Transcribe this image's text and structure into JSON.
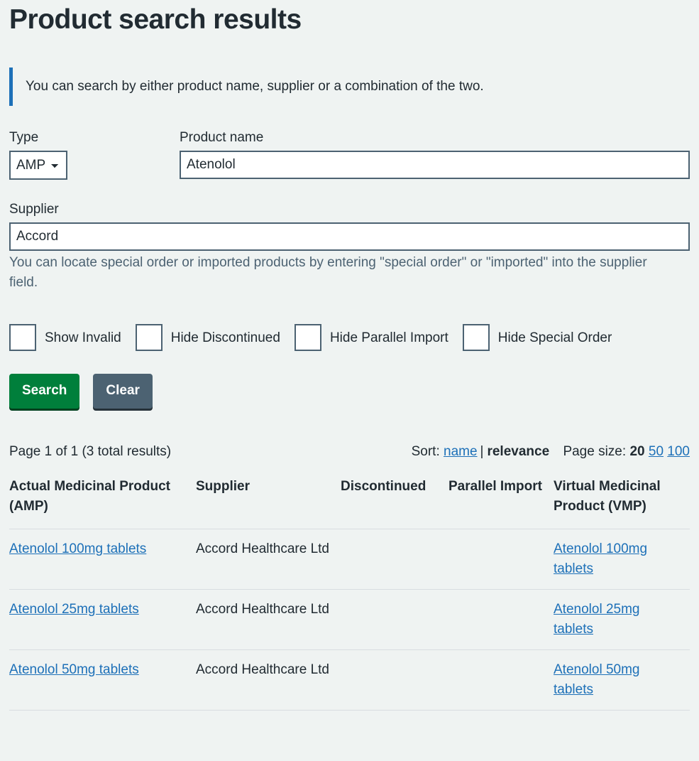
{
  "page": {
    "title": "Product search results"
  },
  "callout": {
    "text": "You can search by either product name, supplier or a combination of the two."
  },
  "form": {
    "type": {
      "label": "Type",
      "value": "AMP",
      "options": [
        "AMP"
      ]
    },
    "product_name": {
      "label": "Product name",
      "value": "Atenolol",
      "placeholder": ""
    },
    "supplier": {
      "label": "Supplier",
      "value": "Accord",
      "placeholder": "",
      "hint": "You can locate special order or imported products by entering \"special order\" or \"imported\" into the supplier field."
    },
    "checkboxes": [
      {
        "label": "Show Invalid",
        "checked": false
      },
      {
        "label": "Hide Discontinued",
        "checked": false
      },
      {
        "label": "Hide Parallel Import",
        "checked": false
      },
      {
        "label": "Hide Special Order",
        "checked": false
      }
    ],
    "buttons": {
      "search": "Search",
      "clear": "Clear"
    }
  },
  "results": {
    "summary": "Page 1 of 1 (3 total results)",
    "sort": {
      "label": "Sort:",
      "name_option": "name",
      "separator": "|",
      "relevance_option": "relevance"
    },
    "page_size": {
      "label": "Page size:",
      "current": "20",
      "options": [
        "50",
        "100"
      ]
    },
    "columns": [
      "Actual Medicinal Product (AMP)",
      "Supplier",
      "Discontinued",
      "Parallel Import",
      "Virtual Medicinal Product (VMP)"
    ],
    "rows": [
      {
        "amp": "Atenolol 100mg tablets",
        "supplier": "Accord Healthcare Ltd",
        "discontinued": "",
        "parallel_import": "",
        "vmp": "Atenolol 100mg tablets"
      },
      {
        "amp": "Atenolol 25mg tablets",
        "supplier": "Accord Healthcare Ltd",
        "discontinued": "",
        "parallel_import": "",
        "vmp": "Atenolol 25mg tablets"
      },
      {
        "amp": "Atenolol 50mg tablets",
        "supplier": "Accord Healthcare Ltd",
        "discontinued": "",
        "parallel_import": "",
        "vmp": "Atenolol 50mg tablets"
      }
    ]
  },
  "colors": {
    "background": "#eff3f2",
    "text": "#212b32",
    "link": "#1d70b8",
    "callout_bar": "#1d70b8",
    "border": "#4c6272",
    "search_button": "#007f3b",
    "clear_button": "#4c6272",
    "hint_text": "#4c6272",
    "table_border": "#d8dde0"
  }
}
